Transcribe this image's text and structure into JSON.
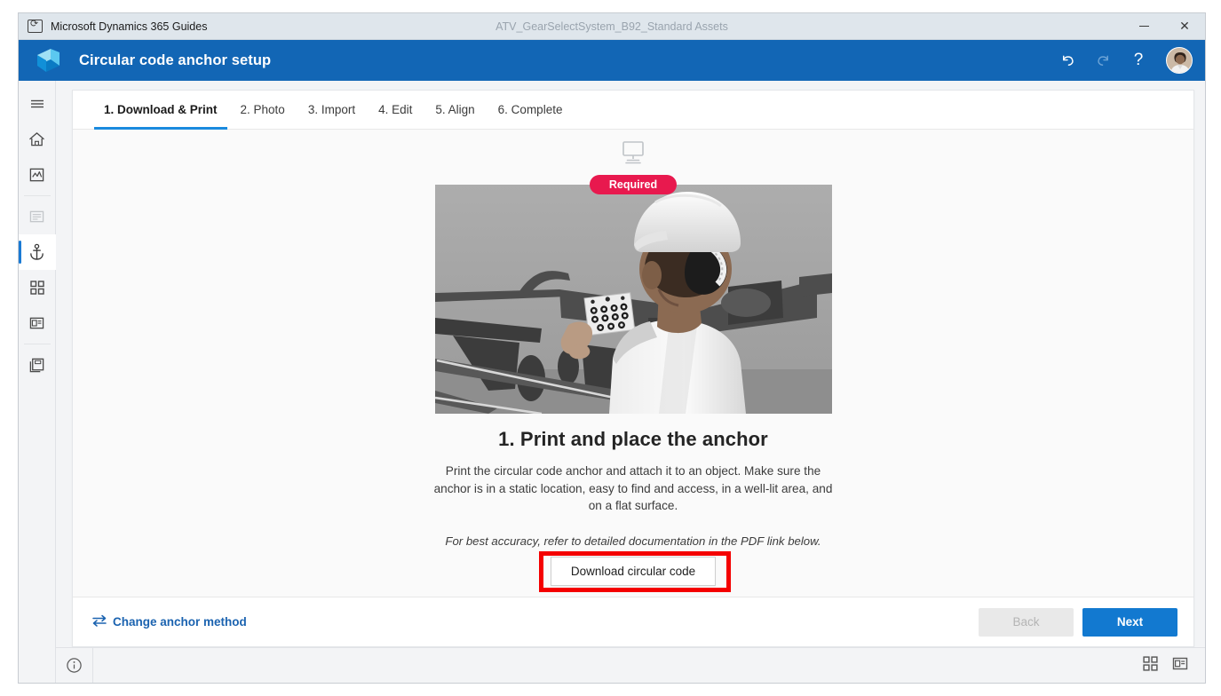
{
  "window": {
    "app_name": "Microsoft Dynamics 365 Guides",
    "document_title": "ATV_GearSelectSystem_B92_Standard Assets",
    "app_icon": "guides-app-icon",
    "minimize_label": "−",
    "close_label": "✕"
  },
  "command_bar": {
    "logo": "dynamics-365-logo",
    "title": "Circular code anchor setup",
    "undo": {
      "label": "↶",
      "name": "undo-icon",
      "enabled": true
    },
    "redo": {
      "label": "↷",
      "name": "redo-icon",
      "enabled": false
    },
    "help": {
      "label": "?",
      "name": "help-icon"
    },
    "avatar": "user-avatar"
  },
  "sidebar": {
    "items": [
      {
        "name": "hamburger-menu-icon",
        "icon": "hamburger",
        "state": "normal"
      },
      {
        "name": "home-icon",
        "icon": "home",
        "state": "normal"
      },
      {
        "name": "media-library-icon",
        "icon": "image-chart",
        "state": "normal"
      },
      {
        "name": "steps-document-icon",
        "icon": "document",
        "state": "dim"
      },
      {
        "name": "anchor-icon",
        "icon": "anchor",
        "state": "active"
      },
      {
        "name": "apps-grid-icon",
        "icon": "grid",
        "state": "normal"
      },
      {
        "name": "layout-panel-icon",
        "icon": "panel",
        "state": "normal"
      },
      {
        "name": "save-copy-icon",
        "icon": "save",
        "state": "normal"
      }
    ]
  },
  "wizard": {
    "tabs": [
      {
        "label": "1. Download & Print",
        "active": true
      },
      {
        "label": "2. Photo",
        "active": false
      },
      {
        "label": "3. Import",
        "active": false
      },
      {
        "label": "4. Edit",
        "active": false
      },
      {
        "label": "5. Align",
        "active": false
      },
      {
        "label": "6. Complete",
        "active": false
      }
    ],
    "device_icon": "desktop-monitor-icon",
    "required_badge": "Required",
    "illustration_alt": "worker-placing-circular-code-anchor",
    "step_title": "1. Print and place the anchor",
    "step_description": "Print the circular code anchor and attach it to an object. Make sure the anchor is in a static location, easy to find and access, in a well-lit area, and on a flat surface.",
    "step_note": "For best accuracy, refer to detailed documentation in the PDF link below.",
    "download_button": "Download circular code",
    "annotation_color": "#f40000",
    "footer": {
      "change_anchor_method": "Change anchor method",
      "change_anchor_icon": "swap-arrows-icon",
      "back_button": "Back",
      "next_button": "Next",
      "back_enabled": false
    }
  },
  "status_bar": {
    "info_icon": "info-circle-icon",
    "right_icons": [
      {
        "name": "grid-view-icon"
      },
      {
        "name": "panel-view-icon"
      }
    ]
  },
  "colors": {
    "command_bar": "#1266b5",
    "accent_blue": "#1279d0",
    "tab_underline": "#1a8ade",
    "required_badge": "#e8194e",
    "annotation_red": "#f40000",
    "link_blue": "#1b63b0"
  }
}
